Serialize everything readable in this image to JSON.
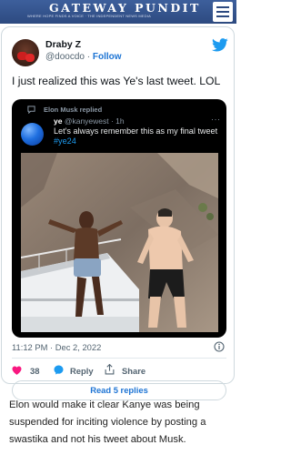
{
  "site": {
    "brand": "GATEWAY PUNDIT",
    "tagline": "WHERE HOPE FINDS A VOICE · THE INDEPENDENT NEWS MEDIA",
    "menu_icon": "hamburger-menu-icon"
  },
  "tweet": {
    "author_name": "Draby Z",
    "author_handle": "@doocdo",
    "separator": " · ",
    "follow_label": "Follow",
    "text": "I just realized this was Ye's last tweet. LOL",
    "timestamp": "11:12 PM · Dec 2, 2022",
    "likes": "38",
    "reply_label": "Reply",
    "share_label": "Share",
    "read_replies_label": "Read 5 replies",
    "colors": {
      "twitter_blue": "#1d9bf0",
      "heart_pink": "#f91880",
      "link_blue": "#1d74d4"
    }
  },
  "quoted": {
    "replied_label": "Elon Musk replied",
    "name": "ye",
    "handle_time": "@kanyewest · 1h",
    "dots": "···",
    "text": "Let's always remember this as my final tweet",
    "hashtag": "#ye24"
  },
  "article": {
    "text": "Elon would make it clear Kanye was being suspended for inciting violence by posting a swastika and not his tweet about Musk."
  }
}
